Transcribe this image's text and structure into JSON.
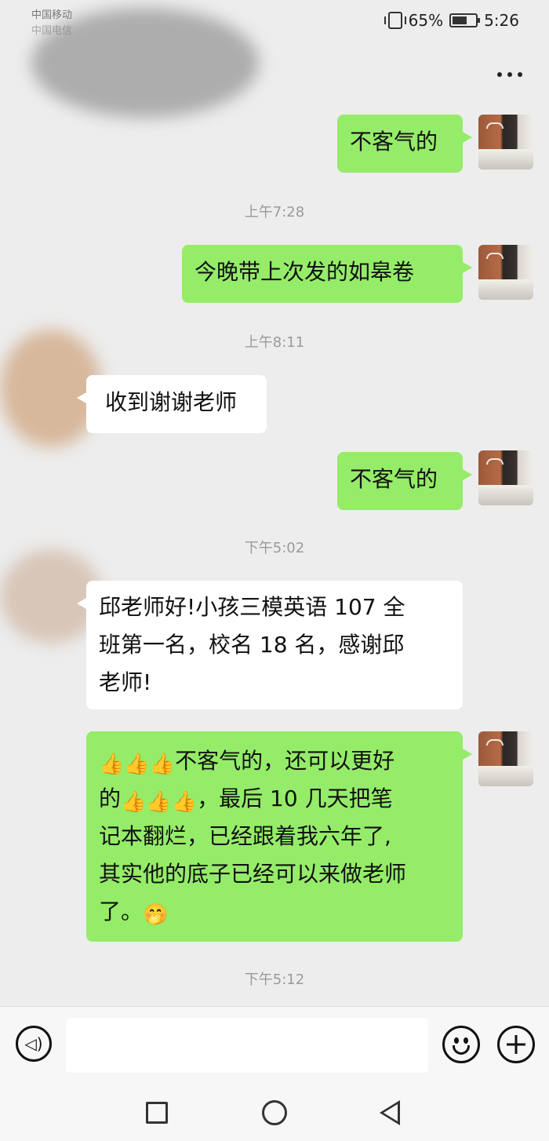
{
  "status_bar": {
    "carrier_1": "中国移动",
    "carrier_2": "中国电信",
    "battery": "65%",
    "time": "5:26"
  },
  "header": {
    "more_icon": "more-dots-icon"
  },
  "messages": [
    {
      "type": "sent",
      "lines": [
        "不客气的"
      ]
    },
    {
      "type": "timestamp",
      "text": "上午7:28"
    },
    {
      "type": "sent",
      "lines": [
        "今晚带上次发的如皋卷"
      ]
    },
    {
      "type": "timestamp",
      "text": "上午8:11"
    },
    {
      "type": "received",
      "lines": [
        "收到谢谢老师"
      ]
    },
    {
      "type": "sent",
      "lines": [
        "不客气的"
      ]
    },
    {
      "type": "timestamp",
      "text": "下午5:02"
    },
    {
      "type": "received",
      "lines": [
        "邱老师好!小孩三模英语 107 全",
        "班第一名，校名 18 名，感谢邱",
        "老师!"
      ]
    },
    {
      "type": "sent",
      "lines": [
        "不客气的，还可以更好",
        "的",
        "，最后 10 几天把笔",
        "记本翻烂，已经跟着我六年了,",
        "其实他的底子已经可以来做老师",
        "了。"
      ]
    },
    {
      "type": "timestamp",
      "text": "下午5:12"
    }
  ],
  "emojis": {
    "thumbs_up": "👍",
    "face": "🤭"
  },
  "input_bar": {
    "voice_icon": "voice-icon",
    "emoji_icon": "smiley-icon",
    "plus_icon": "plus-icon",
    "input_value": ""
  },
  "nav_bar": {
    "recent_icon": "square-icon",
    "home_icon": "circle-icon",
    "back_icon": "back-triangle-icon"
  },
  "colors": {
    "background": "#ededed",
    "sent_bubble": "#95ec69",
    "received_bubble": "#ffffff",
    "timestamp": "#9a9a9a"
  }
}
